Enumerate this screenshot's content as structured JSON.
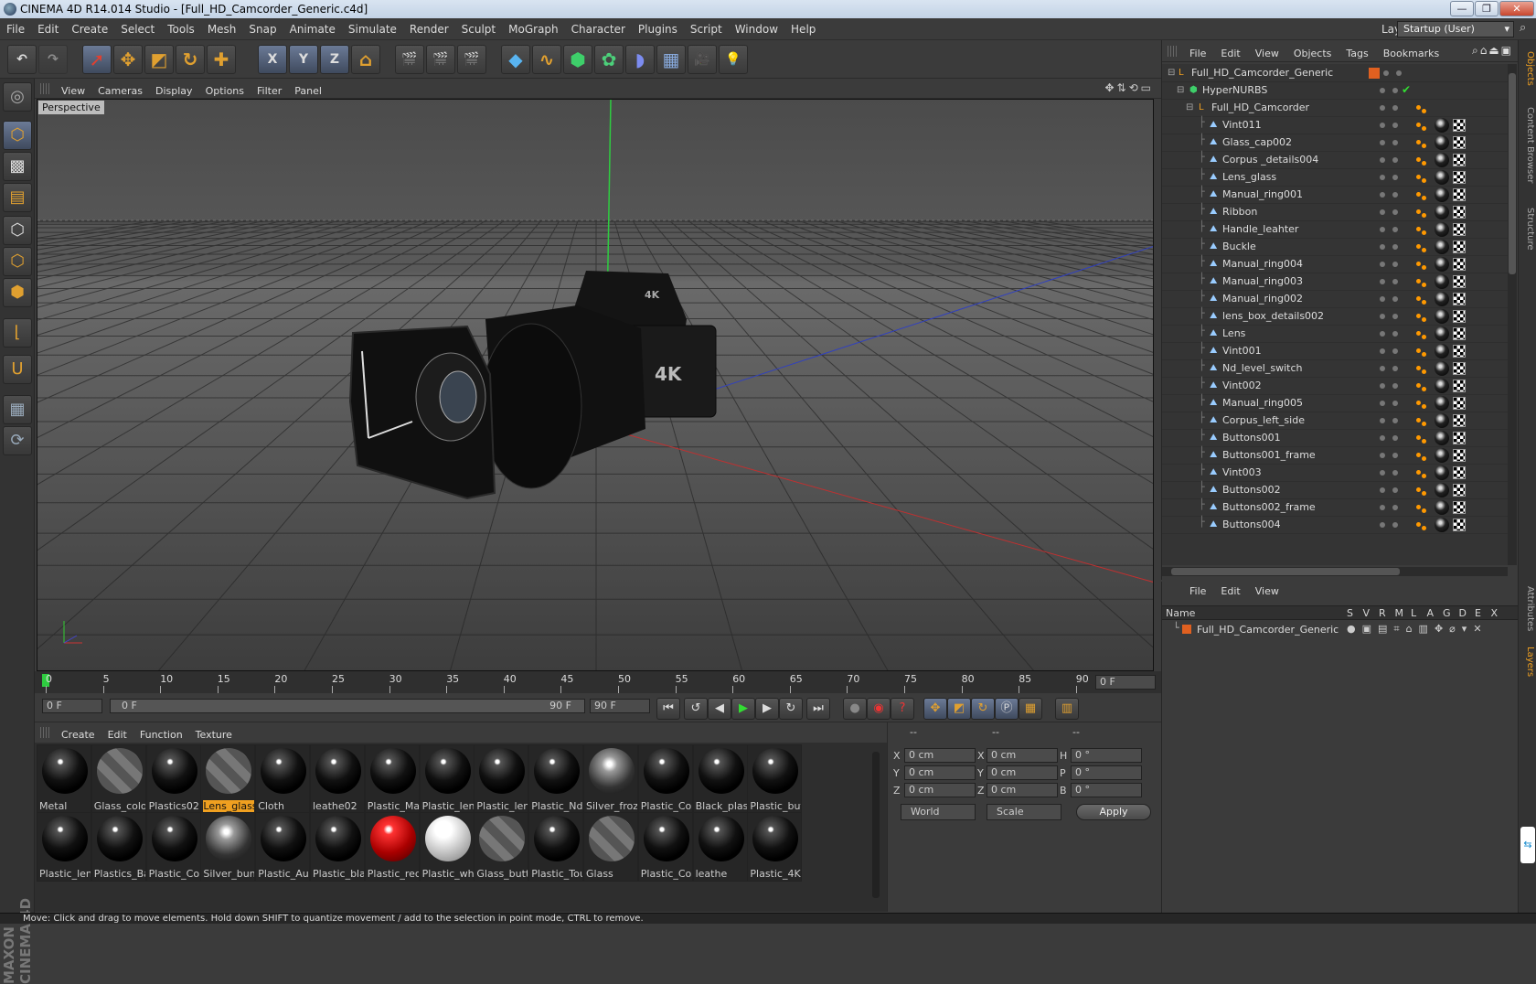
{
  "window": {
    "title": "CINEMA 4D R14.014 Studio - [Full_HD_Camcorder_Generic.c4d]",
    "btn_min": "—",
    "btn_max": "❐",
    "btn_close": "✕"
  },
  "menu": {
    "items": [
      "File",
      "Edit",
      "Create",
      "Select",
      "Tools",
      "Mesh",
      "Snap",
      "Animate",
      "Simulate",
      "Render",
      "Sculpt",
      "MoGraph",
      "Character",
      "Plugins",
      "Script",
      "Window",
      "Help"
    ],
    "layout_label": "Layout:",
    "layout_value": "Startup (User)"
  },
  "toolbar": {
    "undo": "↶",
    "redo": "↷",
    "x_axis": "X",
    "y_axis": "Y",
    "z_axis": "Z"
  },
  "viewport": {
    "menu": [
      "View",
      "Cameras",
      "Display",
      "Options",
      "Filter",
      "Panel"
    ],
    "label": "Perspective",
    "screen_text_1": "4K",
    "screen_text_2": "4K"
  },
  "timeline": {
    "ticks": [
      "0",
      "5",
      "10",
      "15",
      "20",
      "25",
      "30",
      "35",
      "40",
      "45",
      "50",
      "55",
      "60",
      "65",
      "70",
      "75",
      "80",
      "85",
      "90"
    ],
    "current_frame": "0 F"
  },
  "transport": {
    "start": "0 F",
    "range_start": "0 F",
    "range_end": "90 F",
    "end": "90 F"
  },
  "materials": {
    "menu": [
      "Create",
      "Edit",
      "Function",
      "Texture"
    ],
    "row1": [
      "Metal",
      "Glass_color",
      "Plastics02",
      "Lens_glass",
      "Cloth",
      "leathe02",
      "Plastic_Mar",
      "Plastic_lens",
      "Plastic_lens",
      "Plastic_Nd_",
      "Silver_froze",
      "Plastic_Cor",
      "Black_plast",
      "Plastic_but"
    ],
    "row2": [
      "Plastic_lens",
      "Plastics_Ba",
      "Plastic_Cor",
      "Silver_bum",
      "Plastic_Auc",
      "Plastic_blac",
      "Plastic_red",
      "Plastic_whi",
      "Glass_butt",
      "Plastic_Tou",
      "Glass",
      "Plastic_Cor",
      "leathe",
      "Plastic_4K"
    ],
    "selected": "Lens_glass"
  },
  "coords": {
    "head": [
      "--",
      "--",
      "--"
    ],
    "labels_pos": [
      "X",
      "Y",
      "Z"
    ],
    "labels_size": [
      "X",
      "Y",
      "Z"
    ],
    "labels_rot": [
      "H",
      "P",
      "B"
    ],
    "pos_values": [
      "0 cm",
      "0 cm",
      "0 cm"
    ],
    "size_values": [
      "0 cm",
      "0 cm",
      "0 cm"
    ],
    "rot_values": [
      "0 °",
      "0 °",
      "0 °"
    ],
    "mode_world": "World",
    "mode_scale": "Scale",
    "apply": "Apply"
  },
  "objects": {
    "menu": [
      "File",
      "Edit",
      "View",
      "Objects",
      "Tags",
      "Bookmarks"
    ],
    "root": "Full_HD_Camcorder_Generic",
    "hypernurbs": "HyperNURBS",
    "group": "Full_HD_Camcorder",
    "children": [
      "Vint011",
      "Glass_cap002",
      "Corpus _details004",
      "Lens_glass",
      "Manual_ring001",
      "Ribbon",
      "Handle_leahter",
      "Buckle",
      "Manual_ring004",
      "Manual_ring003",
      "Manual_ring002",
      "lens_box_details002",
      "Lens",
      "Vint001",
      "Nd_level_switch",
      "Vint002",
      "Manual_ring005",
      "Corpus_left_side",
      "Buttons001",
      "Buttons001_frame",
      "Vint003",
      "Buttons002",
      "Buttons002_frame",
      "Buttons004"
    ]
  },
  "layers": {
    "menu": [
      "File",
      "Edit",
      "View"
    ],
    "col_name": "Name",
    "cols": [
      "S",
      "V",
      "R",
      "M",
      "L",
      "A",
      "G",
      "D",
      "E",
      "X"
    ],
    "row": "Full_HD_Camcorder_Generic"
  },
  "sidetabs": [
    "Objects",
    "Content Browser",
    "Structure",
    "Attributes",
    "Layers"
  ],
  "status": "Move: Click and drag to move elements. Hold down SHIFT to quantize movement / add to the selection in point mode, CTRL to remove.",
  "branding": "MAXON CINEMA 4D",
  "colors": {
    "accent": "#f0a020",
    "selection": "#6b7a96",
    "grid_x": "#c03030",
    "grid_y": "#30c030",
    "grid_z": "#3040c0"
  }
}
